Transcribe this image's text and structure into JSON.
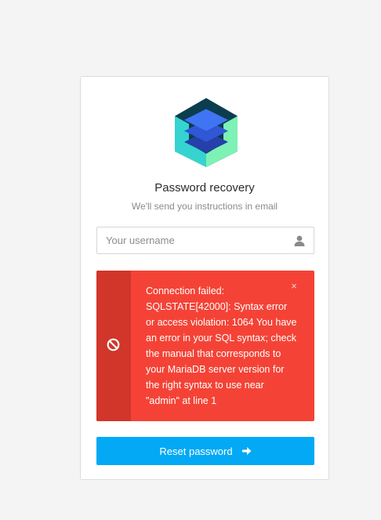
{
  "login": {
    "title": "Password recovery",
    "subtitle": "We'll send you instructions in email",
    "username_placeholder": "Your username",
    "username_value": "",
    "username_icon": "user-icon"
  },
  "alert": {
    "icon": "ban-icon",
    "message": "Connection failed: SQLSTATE[42000]: Syntax error or access violation: 1064 You have an error in your SQL syntax; check the manual that corresponds to your MariaDB server version for the right syntax to use near \"admin\" at line 1",
    "close_label": "×",
    "color": "#f44336",
    "side_color": "#d2352a"
  },
  "reset_button": {
    "label": "Reset password",
    "icon": "arrow-right-icon",
    "color": "#03a9f4"
  },
  "logo": {
    "icon": "hexagon-stack-logo",
    "colors": [
      "#0b3d4f",
      "#2fd0c8",
      "#7af0b0",
      "#3d6df0",
      "#2b4fc7"
    ]
  }
}
